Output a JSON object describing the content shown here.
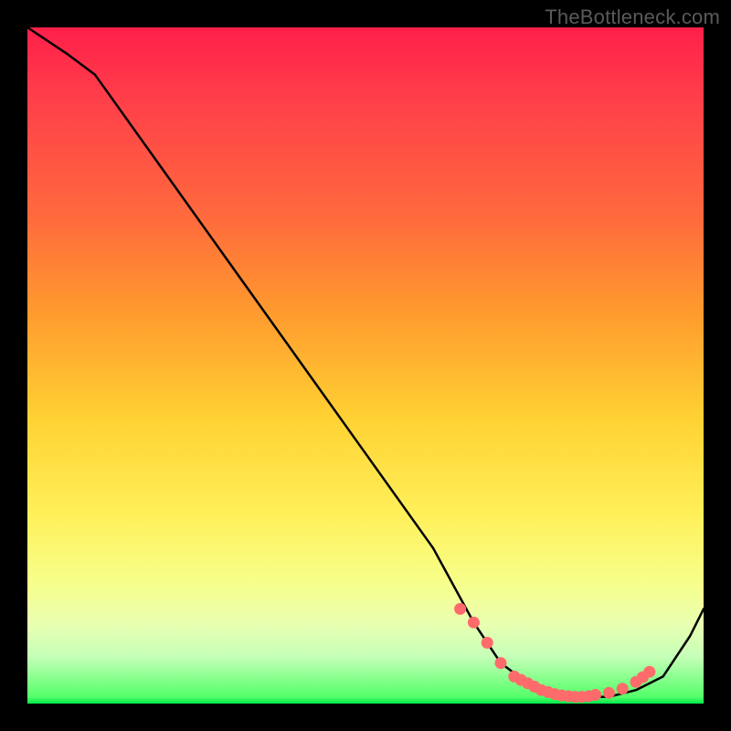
{
  "watermark": "TheBottleneck.com",
  "colors": {
    "curve_stroke": "#000000",
    "marker_fill": "#ff6b6b",
    "marker_stroke": "#ff6b6b"
  },
  "chart_data": {
    "type": "line",
    "title": "",
    "xlabel": "",
    "ylabel": "",
    "xlim": [
      0,
      100
    ],
    "ylim": [
      0,
      100
    ],
    "series": [
      {
        "name": "bottleneck-curve",
        "x": [
          0,
          6,
          10,
          20,
          30,
          40,
          50,
          60,
          66,
          70,
          74,
          78,
          82,
          86,
          90,
          94,
          98,
          100
        ],
        "y": [
          100,
          96,
          93,
          79,
          65,
          51,
          37,
          23,
          12,
          6,
          3,
          1,
          1,
          1,
          2,
          4,
          10,
          14
        ]
      }
    ],
    "markers": {
      "name": "highlighted-points",
      "x": [
        64,
        66,
        68,
        70,
        72,
        73,
        74,
        75,
        76,
        77,
        78,
        79,
        80,
        81,
        82,
        83,
        84,
        86,
        88,
        90,
        91,
        92
      ],
      "y": [
        14,
        12,
        9,
        6,
        4,
        3.5,
        3,
        2.5,
        2,
        1.7,
        1.4,
        1.2,
        1.1,
        1.0,
        1.0,
        1.1,
        1.3,
        1.6,
        2.2,
        3.2,
        3.9,
        4.7
      ]
    }
  }
}
